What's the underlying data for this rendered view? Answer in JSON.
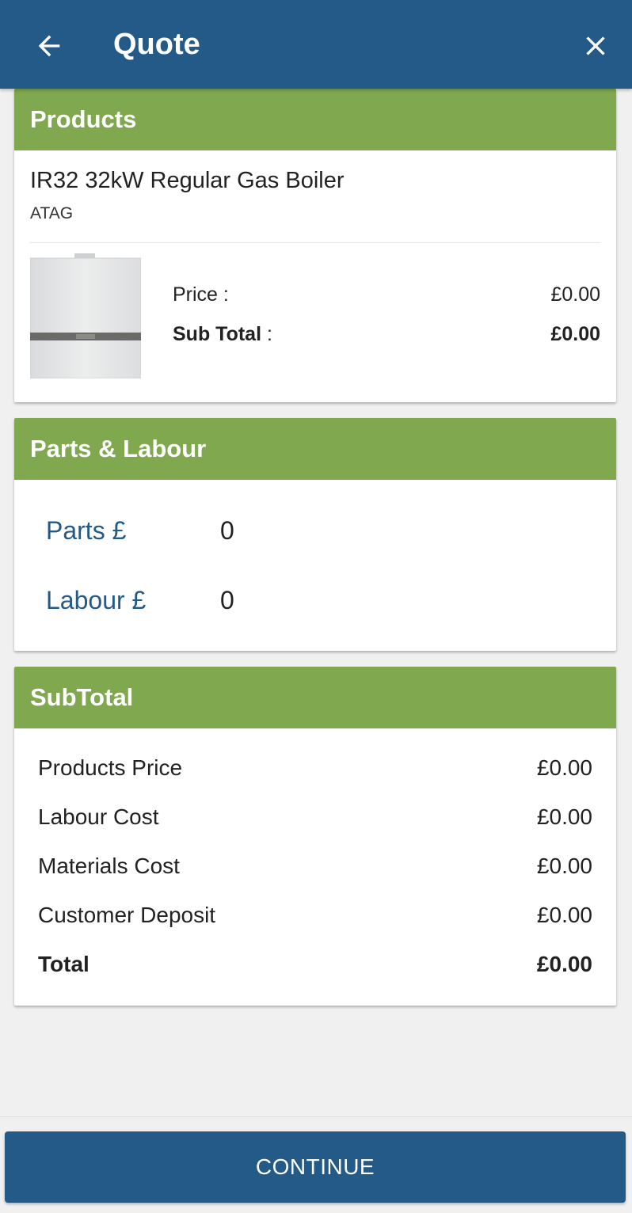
{
  "header": {
    "title": "Quote",
    "back_icon": "arrow-left-icon",
    "close_icon": "close-icon",
    "color": "#235a87"
  },
  "products": {
    "heading": "Products",
    "item": {
      "name": "IR32 32kW Regular Gas Boiler",
      "brand": "ATAG",
      "price_label": "Price :",
      "price": "£0.00",
      "subtotal_label": "Sub Total",
      "subtotal_colon": " :",
      "subtotal": "£0.00"
    }
  },
  "parts_labour": {
    "heading": "Parts & Labour",
    "parts_label": "Parts £",
    "parts_value": "0",
    "labour_label": "Labour £",
    "labour_value": "0"
  },
  "subtotal": {
    "heading": "SubTotal",
    "rows": [
      {
        "label": "Products Price",
        "value": "£0.00"
      },
      {
        "label": "Labour Cost",
        "value": "£0.00"
      },
      {
        "label": "Materials Cost",
        "value": "£0.00"
      },
      {
        "label": "Customer Deposit",
        "value": "£0.00"
      }
    ],
    "total_label": "Total",
    "total_value": "£0.00"
  },
  "footer": {
    "continue_label": "CONTINUE"
  },
  "colors": {
    "section_header": "#7fa84f",
    "primary": "#235a87"
  }
}
